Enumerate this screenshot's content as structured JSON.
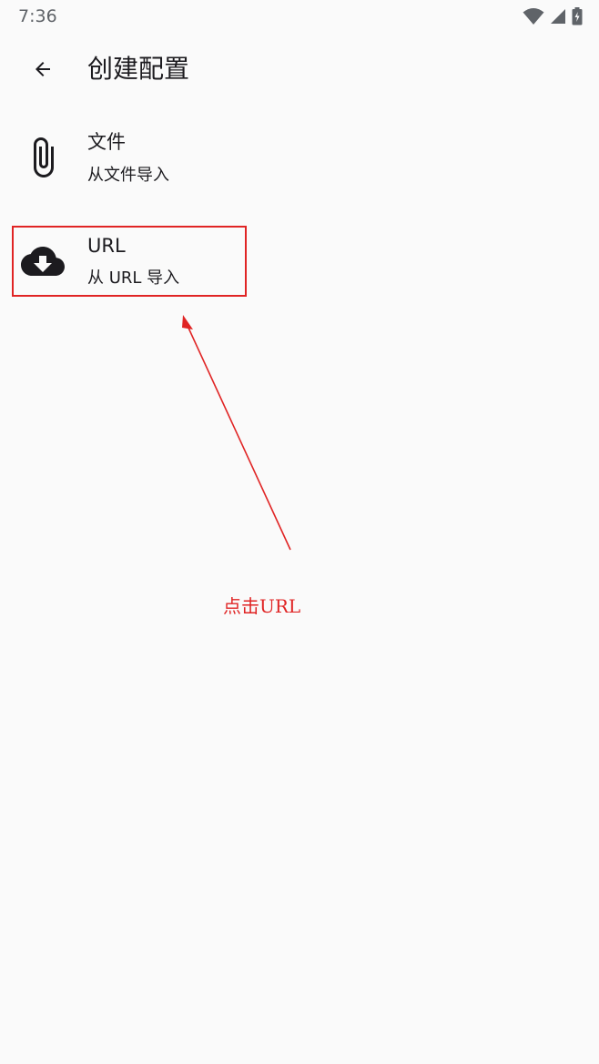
{
  "status_bar": {
    "time": "7:36",
    "icons": [
      "wifi-icon",
      "signal-icon",
      "battery-charging-icon"
    ]
  },
  "app_bar": {
    "back_icon": "arrow-back-icon",
    "title": "创建配置"
  },
  "items": [
    {
      "icon": "paperclip-icon",
      "title": "文件",
      "subtitle": "从文件导入"
    },
    {
      "icon": "cloud-download-icon",
      "title": "URL",
      "subtitle": "从 URL 导入"
    }
  ],
  "annotation": {
    "text": "点击URL",
    "color": "#e02424"
  }
}
